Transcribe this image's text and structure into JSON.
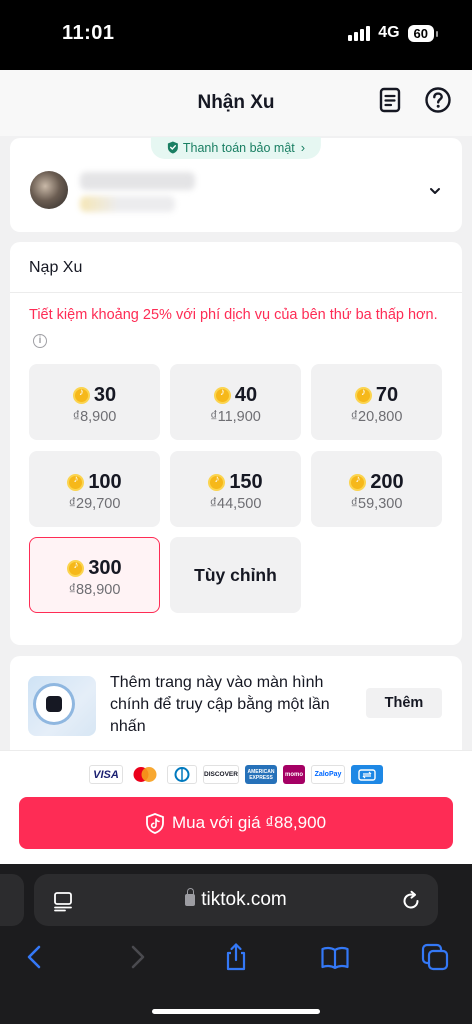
{
  "status_bar": {
    "time": "11:01",
    "network": "4G",
    "battery": "60"
  },
  "header": {
    "title": "Nhận Xu"
  },
  "account": {
    "secure_label": "Thanh toán bảo mật"
  },
  "recharge": {
    "title": "Nạp Xu",
    "promo": "Tiết kiệm khoảng 25% với phí dịch vụ của bên thứ ba thấp hơn.",
    "packages": [
      {
        "amount": "30",
        "price": "₫8,900"
      },
      {
        "amount": "40",
        "price": "₫11,900"
      },
      {
        "amount": "70",
        "price": "₫20,800"
      },
      {
        "amount": "100",
        "price": "₫29,700"
      },
      {
        "amount": "150",
        "price": "₫44,500"
      },
      {
        "amount": "200",
        "price": "₫59,300"
      },
      {
        "amount": "300",
        "price": "₫88,900"
      }
    ],
    "custom_label": "Tùy chỉnh",
    "selected": "300"
  },
  "add_to_home": {
    "text": "Thêm trang này vào màn hình chính để truy cập bằng một lần nhấn",
    "button": "Thêm"
  },
  "payment": {
    "logos": [
      "VISA",
      "mastercard",
      "diners",
      "DISCOVER",
      "AMERICAN EXPRESS",
      "momo",
      "ZaloPay",
      "bank"
    ],
    "buy_label": "Mua với giá ₫88,900"
  },
  "browser": {
    "url": "tiktok.com"
  },
  "colors": {
    "accent": "#fe2c55",
    "secure_green": "#1a7f63",
    "coin": "#f6b81a"
  }
}
